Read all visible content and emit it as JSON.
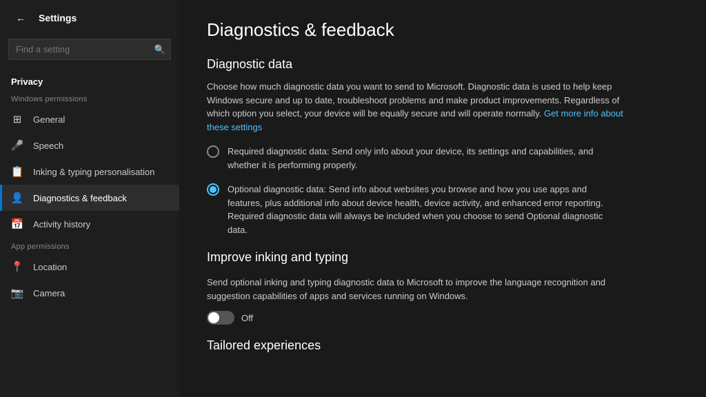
{
  "sidebar": {
    "back_label": "←",
    "title": "Settings",
    "search_placeholder": "Find a setting",
    "privacy_label": "Privacy",
    "windows_permissions_label": "Windows permissions",
    "items_windows": [
      {
        "id": "general",
        "label": "General",
        "icon": "⊞"
      },
      {
        "id": "speech",
        "label": "Speech",
        "icon": "🎤"
      },
      {
        "id": "inking",
        "label": "Inking & typing personalisation",
        "icon": "📋"
      },
      {
        "id": "diagnostics",
        "label": "Diagnostics & feedback",
        "icon": "👤",
        "active": true
      },
      {
        "id": "activity",
        "label": "Activity history",
        "icon": "📅"
      }
    ],
    "app_permissions_label": "App permissions",
    "items_app": [
      {
        "id": "location",
        "label": "Location",
        "icon": "📍"
      },
      {
        "id": "camera",
        "label": "Camera",
        "icon": "📷"
      }
    ]
  },
  "main": {
    "page_title": "Diagnostics & feedback",
    "sections": [
      {
        "id": "diagnostic-data",
        "title": "Diagnostic data",
        "description": "Choose how much diagnostic data you want to send to Microsoft. Diagnostic data is used to help keep Windows secure and up to date, troubleshoot problems and make product improvements. Regardless of which option you select, your device will be equally secure and will operate normally.",
        "link_text": "Get more info about these settings",
        "options": [
          {
            "id": "required",
            "checked": false,
            "label": "Required diagnostic data: Send only info about your device, its settings and capabilities, and whether it is performing properly."
          },
          {
            "id": "optional",
            "checked": true,
            "label": "Optional diagnostic data: Send info about websites you browse and how you use apps and features, plus additional info about device health, device activity, and enhanced error reporting. Required diagnostic data will always be included when you choose to send Optional diagnostic data."
          }
        ]
      },
      {
        "id": "improve-inking",
        "title": "Improve inking and typing",
        "description": "Send optional inking and typing diagnostic data to Microsoft to improve the language recognition and suggestion capabilities of apps and services running on Windows.",
        "toggle": {
          "enabled": false,
          "label": "Off"
        }
      },
      {
        "id": "tailored-experiences",
        "title": "Tailored experiences"
      }
    ]
  }
}
